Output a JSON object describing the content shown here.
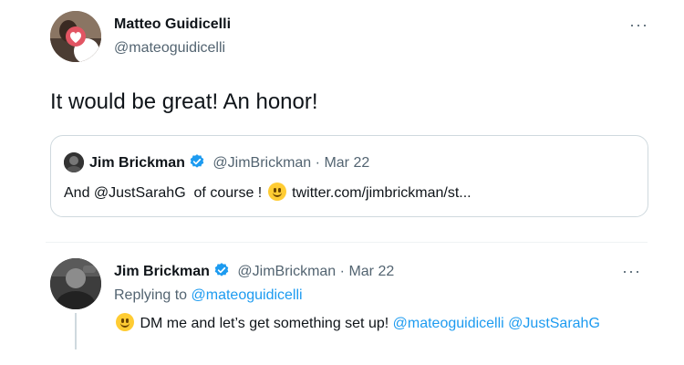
{
  "tweet": {
    "author_name": "Matteo Guidicelli",
    "author_handle": "@mateoguidicelli",
    "text": "It would be great! An honor!",
    "more_label": "···",
    "quote": {
      "author_name": "Jim Brickman",
      "author_handle": "@JimBrickman",
      "separator": "·",
      "date": "Mar 22",
      "text_before": "And @JustSarahG  of course !",
      "link": "twitter.com/jimbrickman/st..."
    }
  },
  "reply": {
    "author_name": "Jim Brickman",
    "author_handle": "@JimBrickman",
    "separator": "·",
    "date": "Mar 22",
    "replying_prefix": "Replying to",
    "replying_to": "@mateoguidicelli",
    "text": "DM me and let’s get something set up!",
    "mention1": "@mateoguidicelli",
    "mention2": "@JustSarahG",
    "more_label": "···"
  },
  "colors": {
    "link": "#1d9bf0",
    "muted": "#536471",
    "verified": "#1d9bf0"
  },
  "icons": [
    "more-icon",
    "verified-badge-icon",
    "grinning-emoji-icon"
  ]
}
